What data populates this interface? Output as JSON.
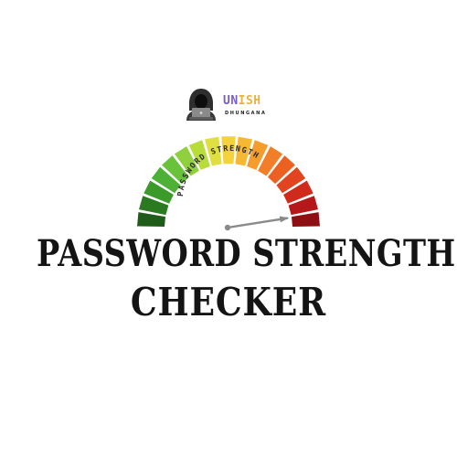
{
  "logo": {
    "name_part_1": "UN",
    "name_part_2": "ISH",
    "subtitle": "DHUNGANA",
    "avatar_icon": "hooded-hacker-laptop-icon"
  },
  "gauge": {
    "arc_label": "PASSWORD STRENGTH",
    "needle_level": 0.95,
    "segment_colors": [
      "#1f5c1a",
      "#2b7a22",
      "#3a9a2a",
      "#4cb135",
      "#68c23a",
      "#8fd03c",
      "#b8dc3a",
      "#dfe040",
      "#f3d23c",
      "#f6b833",
      "#f59c2c",
      "#f27f27",
      "#ec6122",
      "#e2441f",
      "#d02a1c",
      "#b5181a",
      "#8e1012"
    ]
  },
  "title": {
    "line_1": "PASSWORD STRENGTH",
    "line_2": "CHECKER"
  }
}
